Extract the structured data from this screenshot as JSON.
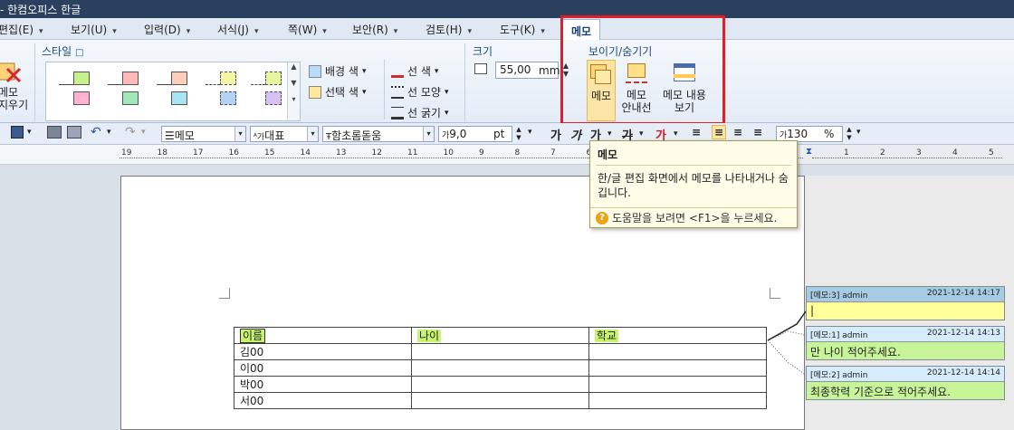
{
  "app": {
    "title": "- 한컴오피스 한글"
  },
  "menu": [
    {
      "label": "편집(E)"
    },
    {
      "label": "보기(U)"
    },
    {
      "label": "입력(D)"
    },
    {
      "label": "서식(J)"
    },
    {
      "label": "쪽(W)"
    },
    {
      "label": "보안(R)"
    },
    {
      "label": "검토(H)"
    },
    {
      "label": "도구(K)"
    }
  ],
  "active_tab": "메모",
  "ribbon": {
    "left_button": "메모\n지우기",
    "style_group": "스타일",
    "bg_color": "배경 색",
    "sel_color": "선택 색",
    "line_color": "선 색",
    "line_shape": "선 모양",
    "line_width": "선 굵기",
    "size_group": "크기",
    "size_value": "55,00",
    "size_unit": "mm",
    "showhide_group": "보이기/숨기기",
    "btn_memo": "메모",
    "btn_guide": "메모\n안내선",
    "btn_content": "메모 내용\n보기"
  },
  "format_bar": {
    "style": "메모",
    "lang": "대표",
    "font": "함초롬돋움",
    "size": "9,0",
    "size_unit": "pt",
    "zoom": "130",
    "zoom_unit": "%"
  },
  "ruler": {
    "left_numbers": [
      "19",
      "18",
      "17",
      "16",
      "15",
      "14",
      "13",
      "12",
      "11",
      "10",
      "9",
      "8",
      "7",
      "6",
      "5",
      "4"
    ],
    "right_numbers": [
      "1",
      "2",
      "3",
      "4",
      "5"
    ]
  },
  "table": {
    "headers": [
      "이름",
      "나이",
      "학교"
    ],
    "rows": [
      [
        "김00",
        "",
        ""
      ],
      [
        "이00",
        "",
        ""
      ],
      [
        "박00",
        "",
        ""
      ],
      [
        "서00",
        "",
        ""
      ]
    ]
  },
  "memos": [
    {
      "tag": "[메모:3] admin",
      "date": "2021-12-14 14:17",
      "text": "|",
      "header_color": "#a6cbe3",
      "body_color": "#ffff99"
    },
    {
      "tag": "[메모:1] admin",
      "date": "2021-12-14 14:13",
      "text": "만 나이 적어주세요.",
      "header_color": "#d6ecfa",
      "body_color": "#c9f59a"
    },
    {
      "tag": "[메모:2] admin",
      "date": "2021-12-14 14:14",
      "text": "최종학력 기준으로 적어주세요.",
      "header_color": "#d6ecfa",
      "body_color": "#c9f59a"
    }
  ],
  "tooltip": {
    "title": "메모",
    "body": "한/글 편집 화면에서 메모를 나타내거나 숨깁니다.",
    "help": "도움말을 보려면 <F1>을 누르세요."
  }
}
